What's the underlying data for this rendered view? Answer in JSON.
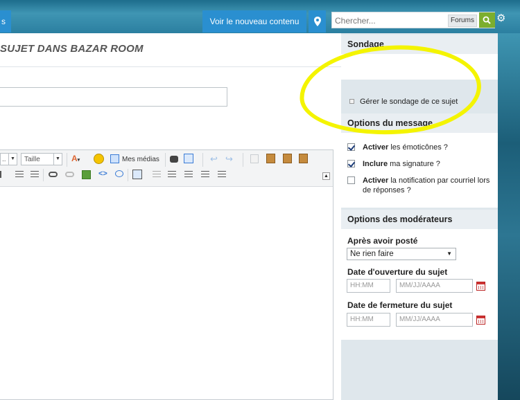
{
  "header": {
    "left_tab_label": "s",
    "new_content_label": "Voir le nouveau contenu",
    "search": {
      "placeholder": "Chercher...",
      "scope": "Forums"
    },
    "icons": [
      "location-pin-icon",
      "search-icon",
      "gear-icon"
    ]
  },
  "main": {
    "page_title": "sujet dans Bazar Room",
    "subject_value": "",
    "editor": {
      "size_select": "Taille",
      "media_label": "Mes médias"
    }
  },
  "sidebar": {
    "poll": {
      "heading": "Sondage",
      "link": "Gérer le sondage de ce sujet"
    },
    "message_options": {
      "heading": "Options du message",
      "items": [
        {
          "bold": "Activer",
          "rest": " les émoticônes ?",
          "checked": true
        },
        {
          "bold": "Inclure",
          "rest": " ma signature ?",
          "checked": true
        },
        {
          "bold": "Activer",
          "rest": " la notification par courriel lors de réponses ?",
          "checked": false
        }
      ]
    },
    "moderator_options": {
      "heading": "Options des modérateurs",
      "after_post_label": "Après avoir posté",
      "after_post_value": "Ne rien faire",
      "open_date_label": "Date d'ouverture du sujet",
      "close_date_label": "Date de fermeture du sujet",
      "time_placeholder": "HH:MM",
      "date_placeholder": "MM/JJ/AAAA"
    }
  },
  "colors": {
    "nav_blue": "#2a8fd0",
    "search_green": "#7cae2e",
    "highlight_yellow": "#f4f400"
  }
}
